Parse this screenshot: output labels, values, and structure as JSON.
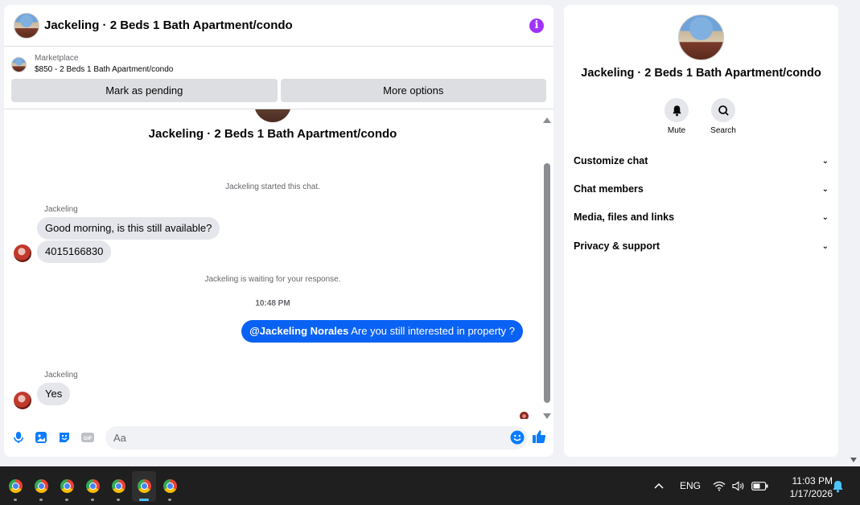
{
  "chat": {
    "header_title": "Jackeling · 2 Beds 1 Bath Apartment/condo",
    "marketplace_label": "Marketplace",
    "listing": "$850 - 2 Beds 1 Bath Apartment/condo",
    "mark_pending": "Mark as pending",
    "more_options": "More options",
    "conversation_title": "Jackeling · 2 Beds 1 Bath Apartment/condo",
    "started_notice": "Jackeling started this chat.",
    "sender_name_1": "Jackeling",
    "msg_1": "Good morning, is this still available?",
    "msg_2": "4015166830",
    "waiting_notice": "Jackeling is waiting for your response.",
    "timestamp": "10:48 PM",
    "out_mention": "@Jackeling Norales",
    "out_text": " Are you still interested in property ?",
    "sender_name_2": "Jackeling",
    "msg_3": "Yes",
    "composer_placeholder": "Aa",
    "composer_icons": [
      "microphone-icon",
      "image-icon",
      "sticker-icon",
      "gif-icon",
      "emoji-icon",
      "like-icon"
    ]
  },
  "info": {
    "title": "Jackeling · 2 Beds 1 Bath Apartment/condo",
    "mute_label": "Mute",
    "search_label": "Search",
    "menu": [
      "Customize chat",
      "Chat members",
      "Media, files and links",
      "Privacy & support"
    ]
  },
  "taskbar": {
    "apps": [
      "chrome",
      "chrome",
      "chrome",
      "chrome",
      "chrome",
      "chrome",
      "chrome"
    ],
    "active_index": 5,
    "language": "ENG",
    "time": "11:03 PM",
    "date": "1/17/2026"
  },
  "colors": {
    "accent": "#0a62f5",
    "info_icon": "#a033ff"
  }
}
